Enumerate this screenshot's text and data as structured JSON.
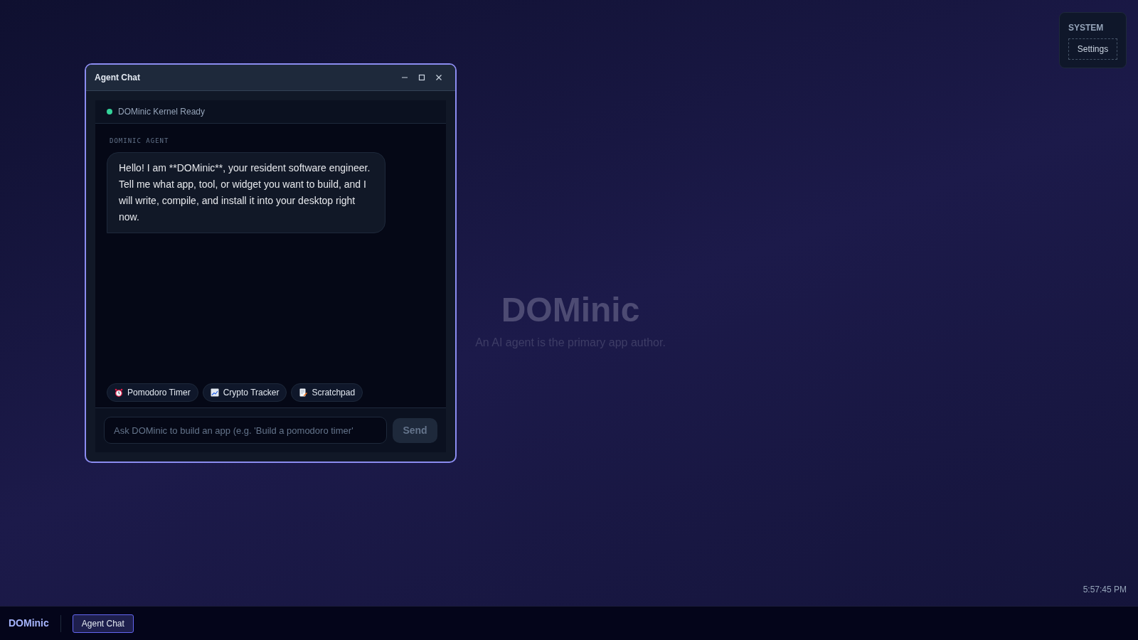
{
  "desktop": {
    "title": "DOMinic",
    "subtitle": "An AI agent is the primary app author.",
    "clock": "5:57:45 PM"
  },
  "system_panel": {
    "heading": "SYSTEM",
    "items": [
      {
        "label": "Settings"
      }
    ]
  },
  "window": {
    "title": "Agent Chat",
    "controls": [
      {
        "kind": "minimize"
      },
      {
        "kind": "maximize"
      },
      {
        "kind": "close"
      }
    ],
    "status": {
      "text": "DOMinic Kernel Ready",
      "color": "#34d399"
    },
    "messages": [
      {
        "sender": "DOMINIC AGENT",
        "text": "Hello! I am **DOMinic**, your resident software engineer. Tell me what app, tool, or widget you want to build, and I will write, compile, and install it into your desktop right now."
      }
    ],
    "suggestions": [
      {
        "kind": "timer",
        "label": "Pomodoro Timer"
      },
      {
        "kind": "chart",
        "label": "Crypto Tracker"
      },
      {
        "kind": "memo",
        "label": "Scratchpad"
      }
    ],
    "input": {
      "placeholder": "Ask DOMinic to build an app (e.g. 'Build a pomodoro timer'"
    },
    "send_button": "Send"
  },
  "taskbar": {
    "brand": "DOMinic",
    "apps": [
      {
        "label": "Agent Chat",
        "selected": true
      }
    ]
  }
}
